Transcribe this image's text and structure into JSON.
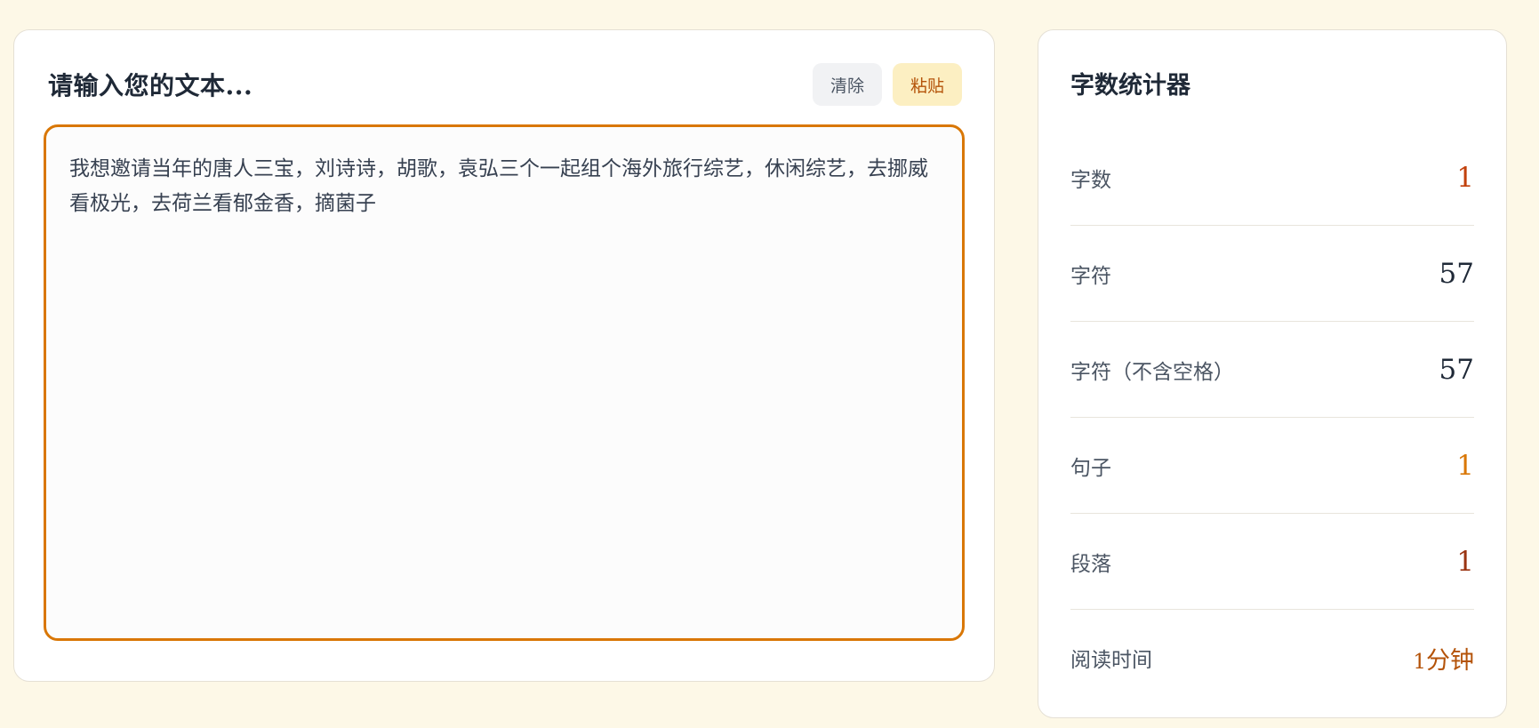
{
  "editor": {
    "title": "请输入您的文本...",
    "clear_label": "清除",
    "paste_label": "粘贴",
    "text": "我想邀请当年的唐人三宝，刘诗诗，胡歌，袁弘三个一起组个海外旅行综艺，休闲综艺，去挪威看极光，去荷兰看郁金香，摘菌子"
  },
  "stats": {
    "title": "字数统计器",
    "items": [
      {
        "label": "字数",
        "value": "1"
      },
      {
        "label": "字符",
        "value": "57"
      },
      {
        "label": "字符（不含空格）",
        "value": "57"
      },
      {
        "label": "句子",
        "value": "1"
      },
      {
        "label": "段落",
        "value": "1"
      },
      {
        "label": "阅读时间",
        "value_num": "1",
        "value_unit": "分钟"
      }
    ]
  },
  "colors": {
    "background": "#fdf8e7",
    "accent": "#d97706",
    "paste_bg": "#fcefc2",
    "clear_bg": "#f1f2f4"
  }
}
